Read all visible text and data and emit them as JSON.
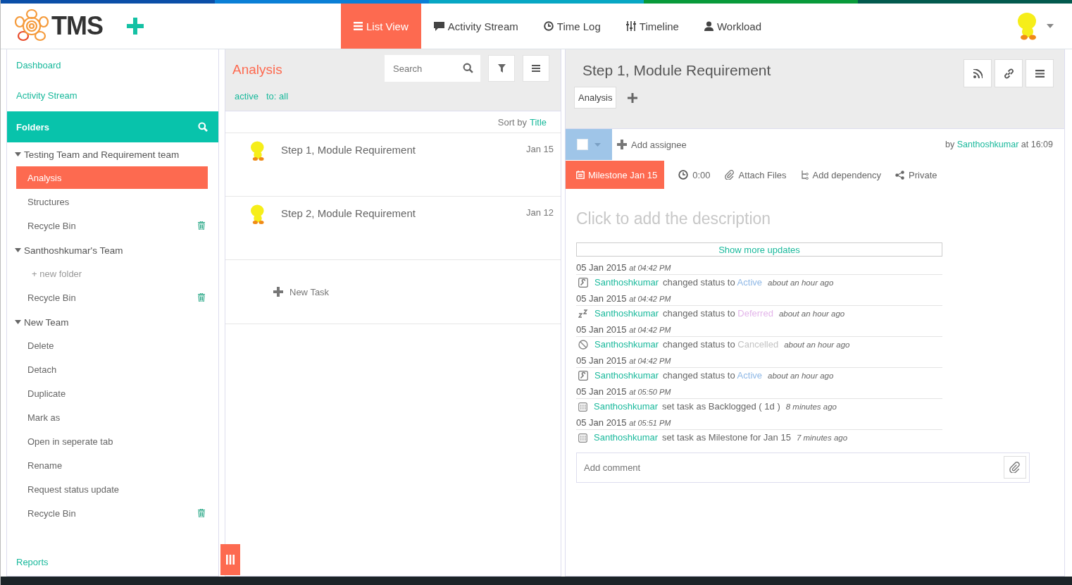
{
  "header": {
    "logo_text": "TMS",
    "nav": [
      {
        "label": "List View",
        "selected": true
      },
      {
        "label": "Activity Stream",
        "selected": false
      },
      {
        "label": "Time Log",
        "selected": false
      },
      {
        "label": "Timeline",
        "selected": false
      },
      {
        "label": "Workload",
        "selected": false
      }
    ]
  },
  "sidebar": {
    "links": [
      "Dashboard",
      "Activity Stream"
    ],
    "folders_title": "Folders",
    "groups": [
      {
        "name": "Testing Team and Requirement team",
        "expanded": true,
        "children": [
          {
            "label": "Analysis",
            "kind": "folder",
            "selected": true
          },
          {
            "label": "Structures",
            "kind": "folder",
            "selected": false
          },
          {
            "label": "Recycle Bin",
            "kind": "bin",
            "selected": false
          }
        ]
      },
      {
        "name": "Santhoshkumar's Team",
        "expanded": true,
        "children": [
          {
            "label": "+ new folder",
            "kind": "new",
            "selected": false
          },
          {
            "label": "Recycle Bin",
            "kind": "bin",
            "selected": false
          }
        ]
      },
      {
        "name": "New Team",
        "expanded": true,
        "children": [
          {
            "label": "Delete",
            "kind": "folder",
            "selected": false
          },
          {
            "label": "Detach",
            "kind": "folder",
            "selected": false
          },
          {
            "label": "Duplicate",
            "kind": "folder",
            "selected": false
          },
          {
            "label": "Mark as",
            "kind": "folder",
            "selected": false
          },
          {
            "label": "Open in seperate tab",
            "kind": "folder",
            "selected": false
          },
          {
            "label": "Rename",
            "kind": "folder",
            "selected": false
          },
          {
            "label": "Request status update",
            "kind": "folder",
            "selected": false
          },
          {
            "label": "Recycle Bin",
            "kind": "bin",
            "selected": false
          }
        ]
      }
    ],
    "reports": "Reports"
  },
  "list": {
    "title": "Analysis",
    "search": {
      "placeholder": "Search"
    },
    "filters": [
      "active",
      "to: all"
    ],
    "sort_label": "Sort by",
    "sort_field": "Title",
    "tasks": [
      {
        "title": "Step 1, Module Requirement",
        "date": "Jan 15"
      },
      {
        "title": "Step 2, Module Requirement",
        "date": "Jan 12"
      }
    ],
    "new_task": "New Task"
  },
  "detail": {
    "title": "Step 1, Module Requirement",
    "tags": [
      "Analysis"
    ],
    "done_checked": false,
    "add_assignee": "Add assignee",
    "by": "by",
    "author": "Santhoshkumar",
    "created": "at 16:09",
    "milestone": "Milestone Jan 15",
    "time": "0:00",
    "attach": "Attach Files",
    "dependency": "Add dependency",
    "privacy": "Private",
    "description": {
      "placeholder": "Click to add the description"
    },
    "show_more": "Show more updates",
    "updates": [
      {
        "date": "05 Jan 2015",
        "time": "at 04:42 PM",
        "user": "Santhoshkumar",
        "kind": "activated",
        "text": "changed status to",
        "status": "Active",
        "color": "#8fb8e6",
        "ago": "about an hour ago"
      },
      {
        "date": "05 Jan 2015",
        "time": "at 04:42 PM",
        "user": "Santhoshkumar",
        "kind": "deferred",
        "text": "changed status to",
        "status": "Deferred",
        "color": "#e3b5ea",
        "ago": "about an hour ago"
      },
      {
        "date": "05 Jan 2015",
        "time": "at 04:42 PM",
        "user": "Santhoshkumar",
        "kind": "cancelled",
        "text": "changed status to",
        "status": "Cancelled",
        "color": "#c3c3c3",
        "ago": "about an hour ago"
      },
      {
        "date": "05 Jan 2015",
        "time": "at 04:42 PM",
        "user": "Santhoshkumar",
        "kind": "activated",
        "text": "changed status to",
        "status": "Active",
        "color": "#8fb8e6",
        "ago": "about an hour ago"
      },
      {
        "date": "05 Jan 2015",
        "time": "at 05:50 PM",
        "user": "Santhoshkumar",
        "kind": "scheduled",
        "text": "set task as Backlogged ( 1d )",
        "ago": "8 minutes ago"
      },
      {
        "date": "05 Jan 2015",
        "time": "at 05:51 PM",
        "user": "Santhoshkumar",
        "kind": "scheduled",
        "text": "set task as Milestone for Jan 15",
        "ago": "7 minutes ago"
      }
    ],
    "comment": {
      "placeholder": "Add comment"
    }
  }
}
